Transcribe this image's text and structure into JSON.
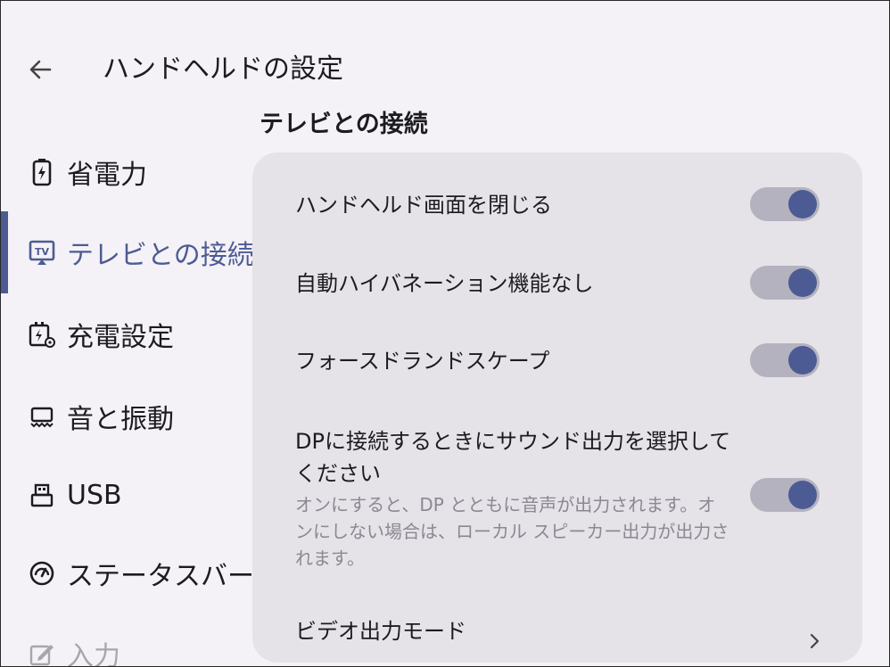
{
  "header": {
    "title": "ハンドヘルドの設定",
    "back_icon": "arrow-left-icon"
  },
  "sidebar": {
    "items": [
      {
        "label": "省電力",
        "icon": "battery-bolt-icon",
        "active": false
      },
      {
        "label": "テレビとの接続",
        "icon": "tv-cast-icon",
        "active": true
      },
      {
        "label": "充電設定",
        "icon": "charging-settings-icon",
        "active": false
      },
      {
        "label": "音と振動",
        "icon": "sound-vibration-icon",
        "active": false
      },
      {
        "label": "USB",
        "icon": "usb-icon",
        "active": false
      },
      {
        "label": "ステータスバー",
        "icon": "gauge-icon",
        "active": false
      },
      {
        "label": "入力",
        "icon": "edit-icon",
        "active": false
      }
    ]
  },
  "section": {
    "title": "テレビとの接続"
  },
  "settings": {
    "rows": [
      {
        "label": "ハンドヘルド画面を閉じる",
        "enabled": true
      },
      {
        "label": "自動ハイバネーション機能なし",
        "enabled": true
      },
      {
        "label": "フォースドランドスケープ",
        "enabled": true
      },
      {
        "label": "DPに接続するときにサウンド出力を選択してください",
        "description": "オンにすると、DP とともに音声が出力されます。オンにしない場合は、ローカル スピーカー出力が出力されます。",
        "enabled": true
      },
      {
        "label": "ビデオ出力モード"
      }
    ]
  },
  "colors": {
    "accent": "#4d5b94",
    "background": "#f4f2f6",
    "card": "#e5e3e8",
    "switch_track": "#b4b2bf"
  }
}
